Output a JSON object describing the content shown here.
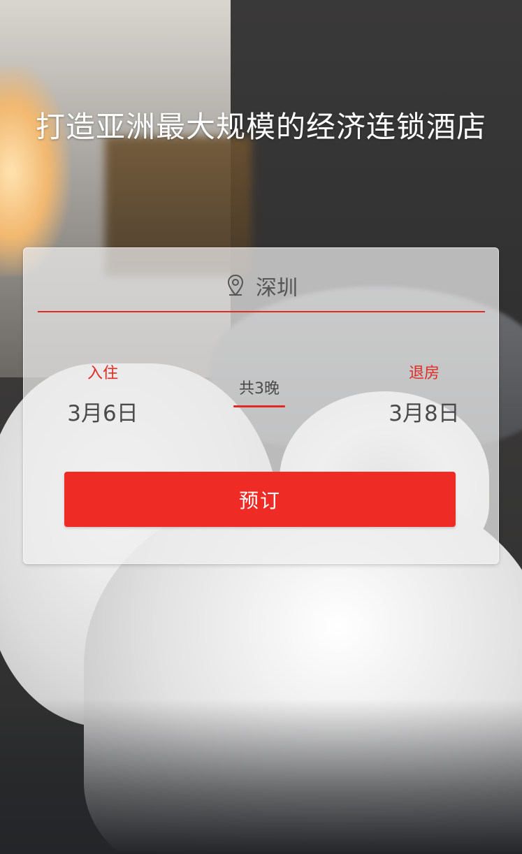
{
  "header": {
    "headline": "打造亚洲最大规模的经济连锁酒店"
  },
  "booking": {
    "city": "深圳",
    "checkin": {
      "label": "入住",
      "date": "3月6日"
    },
    "nights": "共3晚",
    "checkout": {
      "label": "退房",
      "date": "3月8日"
    },
    "book_label": "预订",
    "icons": {
      "location": "location-pin-icon"
    }
  },
  "colors": {
    "accent": "#e02b24",
    "button": "#ee2c25",
    "text": "#4a4a4a"
  }
}
